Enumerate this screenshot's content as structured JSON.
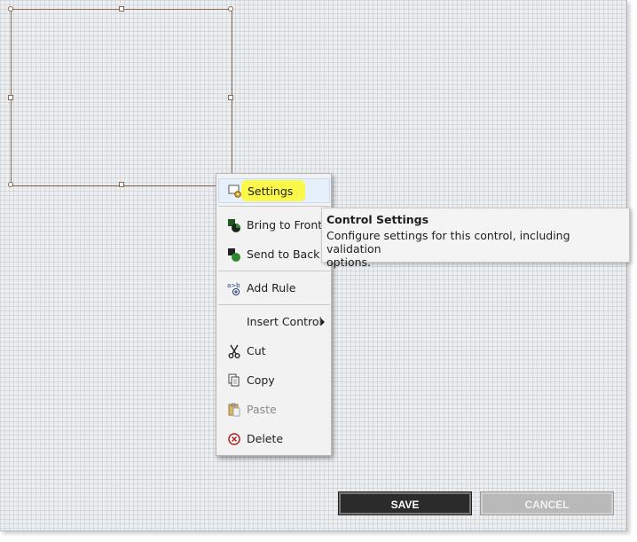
{
  "context_menu": {
    "items": [
      {
        "label": "Settings",
        "icon": "settings-icon",
        "selected": true
      },
      {
        "label": "Bring to Front",
        "icon": "bring-to-front-icon"
      },
      {
        "label": "Send to Back",
        "icon": "send-to-back-icon"
      },
      {
        "label": "Add Rule",
        "icon": "add-rule-icon"
      },
      {
        "label": "Insert Control",
        "has_submenu": true
      },
      {
        "label": "Cut",
        "icon": "scissors-icon"
      },
      {
        "label": "Copy",
        "icon": "copy-icon"
      },
      {
        "label": "Paste",
        "icon": "paste-icon",
        "disabled": true
      },
      {
        "label": "Delete",
        "icon": "delete-icon"
      }
    ]
  },
  "tooltip": {
    "title": "Control Settings",
    "line1": "Configure settings for this control, including validation",
    "line2": "options."
  },
  "buttons": {
    "save_label": "SAVE",
    "cancel_label": "CANCEL"
  },
  "colors": {
    "highlight": "#fbf84a",
    "control_border": "#8a6a52",
    "save_bg": "#2b2b2b",
    "cancel_bg": "#b9b9b9"
  }
}
